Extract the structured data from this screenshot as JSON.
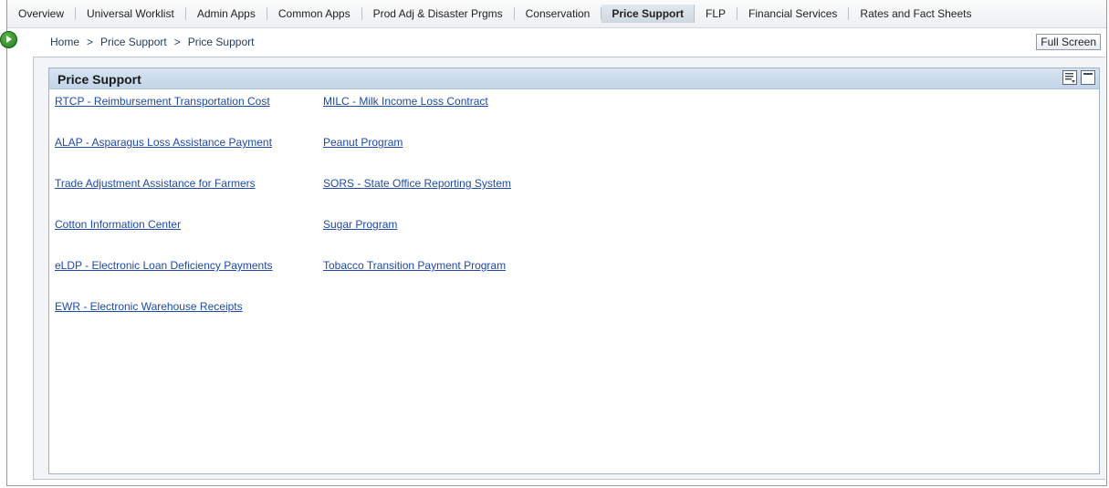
{
  "nav": {
    "tabs": [
      {
        "label": "Overview"
      },
      {
        "label": "Universal Worklist"
      },
      {
        "label": "Admin Apps"
      },
      {
        "label": "Common Apps"
      },
      {
        "label": "Prod Adj & Disaster Prgms"
      },
      {
        "label": "Conservation"
      },
      {
        "label": "Price Support"
      },
      {
        "label": "FLP"
      },
      {
        "label": "Financial Services"
      },
      {
        "label": "Rates and Fact Sheets"
      }
    ],
    "active_tab": "Price Support"
  },
  "breadcrumb": {
    "items": [
      "Home",
      "Price Support",
      "Price Support"
    ],
    "separator": ">"
  },
  "toolbar": {
    "full_screen_label": "Full Screen"
  },
  "panel": {
    "title": "Price Support",
    "left_links": [
      "RTCP - Reimbursement Transportation Cost",
      "ALAP - Asparagus Loss Assistance Payment",
      "Trade Adjustment Assistance for Farmers",
      "Cotton Information Center",
      "eLDP - Electronic Loan Deficiency Payments",
      "EWR - Electronic Warehouse Receipts"
    ],
    "right_links": [
      "MILC - Milk Income Loss Contract",
      "Peanut Program",
      "SORS - State Office Reporting System",
      "Sugar Program",
      "Tobacco Transition Payment Program"
    ]
  },
  "colors": {
    "link": "#1f4aa8",
    "panel_header": "#c9d9ec",
    "go_button": "#2e8b2e"
  }
}
